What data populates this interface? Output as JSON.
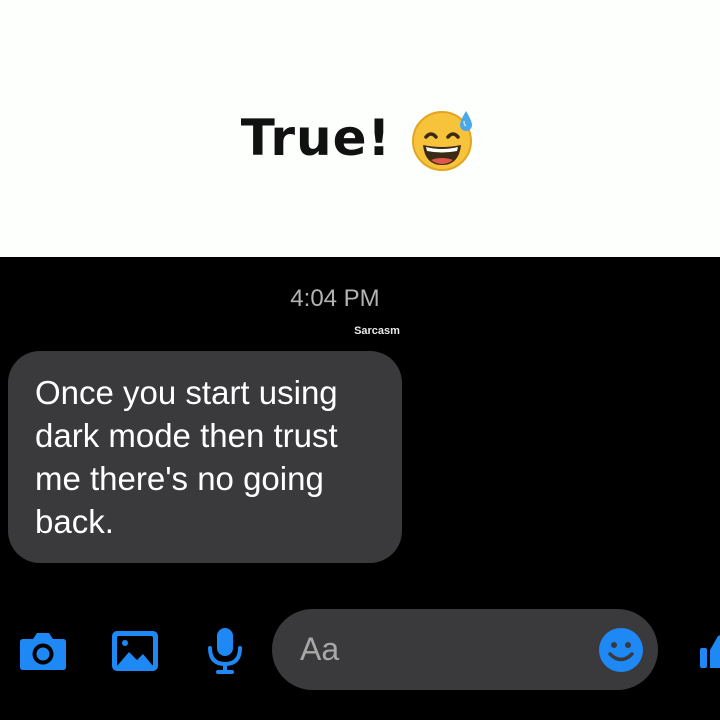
{
  "caption": {
    "text": "True!",
    "emoji_icon": "grinning-face-with-sweat-icon"
  },
  "chat": {
    "timestamp": "4:04 PM",
    "watermark": "Sarcasm",
    "message": {
      "text": "Once you start using dark mode then trust me there's no going back."
    }
  },
  "composer": {
    "icons": [
      "camera-icon",
      "image-icon",
      "microphone-icon",
      "emoji-icon",
      "thumbs-up-icon"
    ],
    "placeholder": "Aa",
    "accent_color": "#1e88f5"
  },
  "colors": {
    "background_top": "#fcfffc",
    "background_chat": "#000000",
    "bubble": "#3a3a3c",
    "accent": "#1e88f5"
  }
}
